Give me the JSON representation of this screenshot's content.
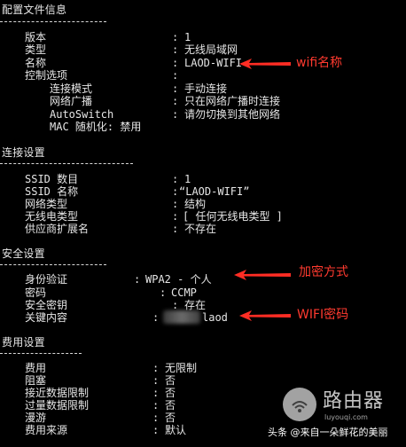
{
  "profile": {
    "heading": "配置文件信息",
    "rows": [
      {
        "key": "版本",
        "value": "1"
      },
      {
        "key": "类型",
        "value": "无线局域网"
      },
      {
        "key": "名称",
        "value": "LAOD-WIFI"
      },
      {
        "key": "控制选项",
        "value": ""
      },
      {
        "key": "连接模式",
        "value": "手动连接"
      },
      {
        "key": "网络广播",
        "value": "只在网络广播时连接"
      },
      {
        "key": "AutoSwitch",
        "value": "请勿切换到其他网络"
      },
      {
        "key": "MAC 随机化: 禁用",
        "value": ""
      }
    ]
  },
  "connectivity": {
    "heading": "连接设置",
    "rows": [
      {
        "key": "SSID 数目",
        "value": "1"
      },
      {
        "key": "SSID 名称",
        "value": "“LAOD-WIFI”"
      },
      {
        "key": "网络类型",
        "value": "结构"
      },
      {
        "key": "无线电类型",
        "value": "[ 任何无线电类型 ]"
      },
      {
        "key": "供应商扩展名",
        "value": "不存在"
      }
    ]
  },
  "security": {
    "heading": "安全设置",
    "rows": [
      {
        "key": "身份验证",
        "value": "WPA2 - 个人"
      },
      {
        "key": "密码",
        "value": "CCMP"
      },
      {
        "key": "安全密钥",
        "value": "存在"
      },
      {
        "key": "关键内容",
        "value": "laod"
      }
    ]
  },
  "cost": {
    "heading": "费用设置",
    "rows": [
      {
        "key": "费用",
        "value": "无限制"
      },
      {
        "key": "阻塞",
        "value": "否"
      },
      {
        "key": "接近数据限制",
        "value": "否"
      },
      {
        "key": "过量数据限制",
        "value": "否"
      },
      {
        "key": "漫游",
        "value": "否"
      },
      {
        "key": "费用来源",
        "value": "默认"
      }
    ]
  },
  "annotations": {
    "wifi_name": "wifi名称",
    "encryption": "加密方式",
    "wifi_password": "WIFI密码",
    "color": "#ff3a2f"
  },
  "watermark": {
    "brand": "路由器",
    "domain": "luyouqi.com",
    "credit": "头条 @来自一朵鲜花的美丽"
  }
}
